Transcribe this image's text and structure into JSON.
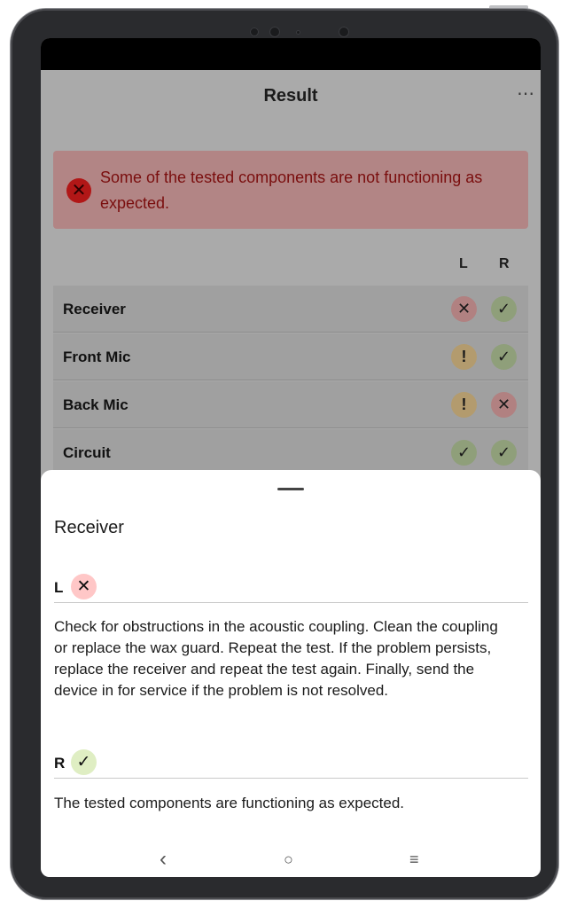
{
  "appbar": {
    "title": "Result",
    "more_icon": "more-horizontal-icon"
  },
  "banner": {
    "text": "Some of the tested components are not functioning as expected.",
    "icon": "error-circle-icon",
    "color": "#b11717"
  },
  "columns": {
    "left": "L",
    "right": "R"
  },
  "components": [
    {
      "name": "Receiver",
      "left": "fail",
      "right": "pass"
    },
    {
      "name": "Front Mic",
      "left": "warn",
      "right": "pass"
    },
    {
      "name": "Back Mic",
      "left": "warn",
      "right": "fail"
    },
    {
      "name": "Circuit",
      "left": "pass",
      "right": "pass"
    }
  ],
  "glyphs": {
    "fail": "✕",
    "pass": "✓",
    "warn": "!"
  },
  "sheet": {
    "title": "Receiver",
    "left": {
      "label": "L",
      "status": "fail",
      "text": "Check for obstructions in the acoustic coupling. Clean the coupling or replace the wax guard. Repeat the test. If the problem persists, replace the receiver and repeat the test again. Finally, send the device in for service if the problem is not resolved."
    },
    "right": {
      "label": "R",
      "status": "pass",
      "text": "The tested components are functioning as expected."
    }
  },
  "navbar": {
    "back": "‹",
    "home": "○",
    "recents": "≡"
  }
}
